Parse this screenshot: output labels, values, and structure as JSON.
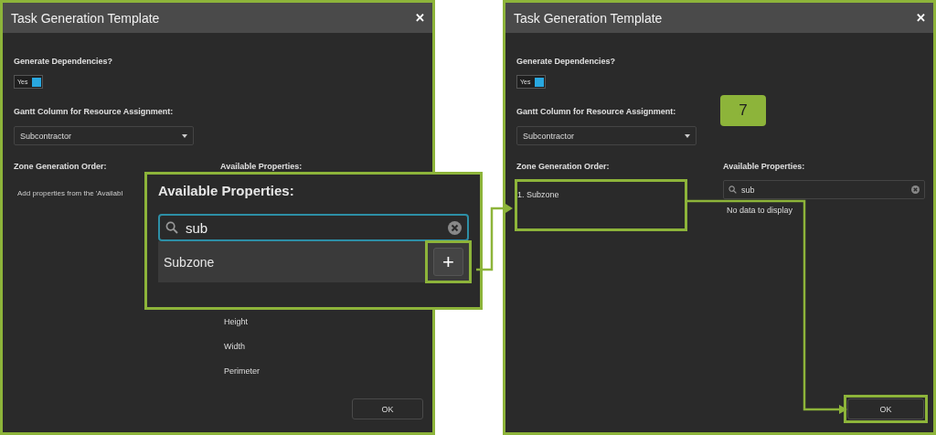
{
  "dialogs": [
    {
      "title": "Task Generation Template",
      "close": "✕",
      "dependencies_label": "Generate Dependencies?",
      "toggle": {
        "label": "Yes",
        "on": true
      },
      "gantt_label": "Gantt Column for Resource Assignment:",
      "gantt_value": "Subcontractor",
      "zone_label": "Zone Generation Order:",
      "zone_hint": "Add properties from the 'Availabl",
      "properties_label": "Available Properties:",
      "properties": [
        "Height",
        "Width",
        "Perimeter"
      ],
      "ok_label": "OK",
      "ok_highlighted": false
    },
    {
      "title": "Task Generation Template",
      "close": "✕",
      "dependencies_label": "Generate Dependencies?",
      "toggle": {
        "label": "Yes",
        "on": true
      },
      "gantt_label": "Gantt Column for Resource Assignment:",
      "gantt_value": "Subcontractor",
      "badge": "7",
      "zone_label": "Zone Generation Order:",
      "zone_items": [
        "1. Subzone"
      ],
      "zone_highlighted": true,
      "properties_label": "Available Properties:",
      "search": {
        "value": "sub"
      },
      "empty_text": "No data to display",
      "ok_label": "OK",
      "ok_highlighted": true
    }
  ],
  "callout": {
    "title": "Available Properties:",
    "search": {
      "value": "sub"
    },
    "result": "Subzone",
    "add_label": "+",
    "add_highlighted": true
  }
}
